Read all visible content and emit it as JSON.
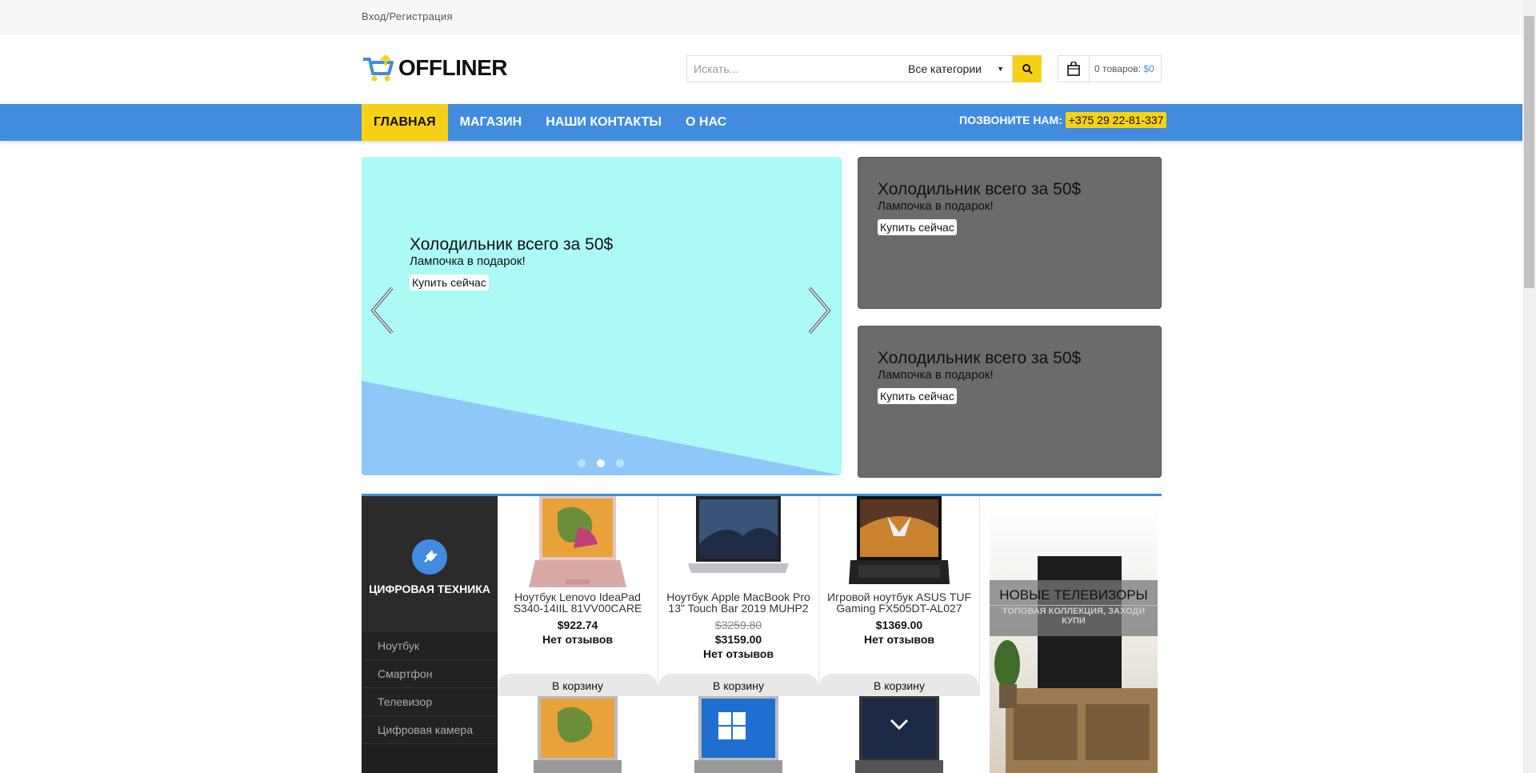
{
  "topbar": {
    "login_label": "Вход/Регистрация"
  },
  "header": {
    "logo_text": "OFFLINER",
    "search_placeholder": "Искать...",
    "category_select": "Все категории",
    "cart_count": "0 товаров:",
    "cart_total": "$0"
  },
  "nav": {
    "items": [
      {
        "label": "ГЛАВНАЯ"
      },
      {
        "label": "МАГАЗИН"
      },
      {
        "label": "НАШИ КОНТАКТЫ"
      },
      {
        "label": "О НАС"
      }
    ],
    "call_label": "ПОЗВОНИТЕ НАМ:",
    "phone": "+375 29 22-81-337"
  },
  "slider": {
    "title": "Холодильник всего за 50$",
    "subtitle": "Лампочка в подарок!",
    "button": "Купить сейчас",
    "active_slide": 2,
    "slide_count": 3
  },
  "banners": [
    {
      "title": "Холодильник всего за 50$",
      "subtitle": "Лампочка в подарок!",
      "button": "Купить сейчас"
    },
    {
      "title": "Холодильник всего за 50$",
      "subtitle": "Лампочка в подарок!",
      "button": "Купить сейчас"
    }
  ],
  "category": {
    "title": "ЦИФРОВАЯ ТЕХНИКА",
    "items": [
      "Ноутбук",
      "Смартфон",
      "Телевизор",
      "Цифровая камера"
    ]
  },
  "products": [
    {
      "name": "Ноутбук Lenovo IdeaPad S340-14IIL 81VV00CARE",
      "price": "$922.74",
      "reviews": "Нет отзывов"
    },
    {
      "name": "Ноутбук Apple MacBook Pro 13\" Touch Bar 2019 MUHP2",
      "old_price": "$3259.80",
      "price": "$3159.00",
      "reviews": "Нет отзывов"
    },
    {
      "name": "Игровой ноутбук ASUS TUF Gaming FX505DT-AL027",
      "price": "$1369.00",
      "reviews": "Нет отзывов"
    }
  ],
  "to_cart_label": "В корзину",
  "promo_tv": {
    "title": "НОВЫЕ ТЕЛЕВИЗОРЫ",
    "subtitle": "ТОПОВАЯ КОЛЛЕКЦИЯ, ЗАХОДИ КУПИ"
  },
  "colors": {
    "accent_blue": "#428bdf",
    "accent_yellow": "#f7d117",
    "slide_bg": "#abfaf5"
  }
}
